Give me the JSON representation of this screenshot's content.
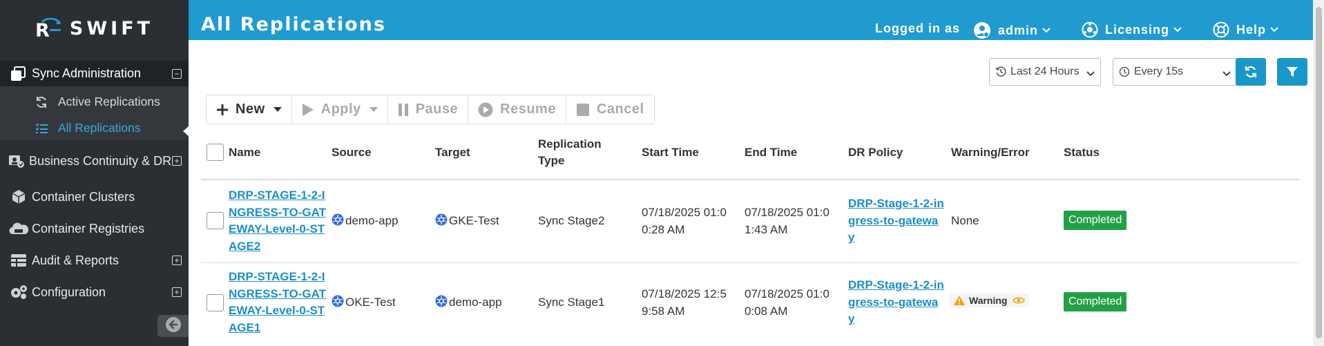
{
  "app": {
    "logo_text": "SWIFT"
  },
  "sidebar": {
    "sections": [
      {
        "label": "Sync Administration",
        "icon": "copy-icon",
        "expander": "⊟"
      },
      {
        "label": "Business Continuity & DR",
        "icon": "business-continuity-icon",
        "expander": "⊞"
      },
      {
        "label": "Container Clusters",
        "icon": "cube-icon"
      },
      {
        "label": "Container Registries",
        "icon": "cloud-icon"
      },
      {
        "label": "Audit & Reports",
        "icon": "table-icon",
        "expander": "⊞"
      },
      {
        "label": "Configuration",
        "icon": "gears-icon",
        "expander": "⊞"
      }
    ],
    "sub_items": [
      {
        "label": "Active Replications",
        "icon": "refresh-icon"
      },
      {
        "label": "All Replications",
        "icon": "list-check-icon"
      }
    ]
  },
  "header": {
    "title": "All Replications",
    "logged_in_label": "Logged in as",
    "user": "admin",
    "licensing": "Licensing",
    "help": "Help"
  },
  "filters": {
    "time_range": "Last 24 Hours",
    "refresh_interval": "Every 15s"
  },
  "toolbar": {
    "new": "New",
    "apply": "Apply",
    "pause": "Pause",
    "resume": "Resume",
    "cancel": "Cancel"
  },
  "table": {
    "headers": {
      "name": "Name",
      "source": "Source",
      "target": "Target",
      "replication_type_1": "Replication",
      "replication_type_2": "Type",
      "start_time": "Start Time",
      "end_time": "End Time",
      "dr_policy": "DR Policy",
      "warning_error": "Warning/Error",
      "status": "Status"
    },
    "rows": [
      {
        "name_lines": [
          "DRP-STAGE-1-2-I",
          "NGRESS-TO-GAT",
          "EWAY-Level-0-ST",
          "AGE2"
        ],
        "source": "demo-app",
        "target": "GKE-Test",
        "type": "Sync Stage2",
        "start_lines": [
          "07/18/2025 01:0",
          "0:28 AM"
        ],
        "end_lines": [
          "07/18/2025 01:0",
          "1:43 AM"
        ],
        "policy_lines": [
          "DRP-Stage-1-2-in",
          "gress-to-gatewa",
          "y"
        ],
        "warning": "None",
        "status": "Completed"
      },
      {
        "name_lines": [
          "DRP-STAGE-1-2-I",
          "NGRESS-TO-GAT",
          "EWAY-Level-0-ST",
          "AGE1"
        ],
        "source": "OKE-Test",
        "target": "demo-app",
        "type": "Sync Stage1",
        "start_lines": [
          "07/18/2025 12:5",
          "9:58 AM"
        ],
        "end_lines": [
          "07/18/2025 01:0",
          "0:08 AM"
        ],
        "policy_lines": [
          "DRP-Stage-1-2-in",
          "gress-to-gatewa",
          "y"
        ],
        "warning": "Warning",
        "status": "Completed"
      }
    ]
  },
  "colors": {
    "header_blue": "#1f9bd0",
    "sidebar_dark": "#2b2e33",
    "link": "#1a8fc4",
    "status_completed": "#23a046",
    "warning": "#f0a500"
  }
}
